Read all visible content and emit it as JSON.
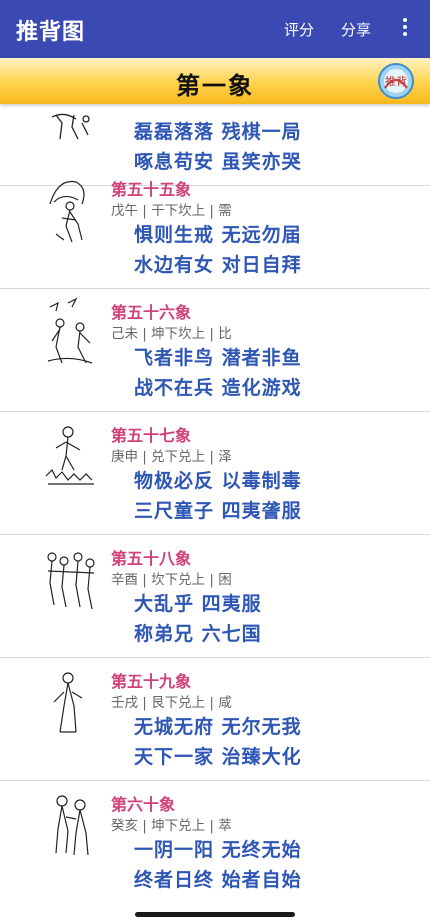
{
  "appbar": {
    "title": "推背图",
    "rate_label": "评分",
    "share_label": "分享",
    "more_icon": "more-vert-icon"
  },
  "banner": {
    "title": "第一象",
    "logo_text": "推背"
  },
  "items": [
    {
      "name": "",
      "gua": "",
      "line1": "磊磊落落  残棋一局",
      "line2": "啄息苟安  虽笑亦哭"
    },
    {
      "name": "第五十五象",
      "gua": "戊午 | 干下坎上 | 需",
      "line1": "惧则生戒  无远勿届",
      "line2": "水边有女  对日自拜"
    },
    {
      "name": "第五十六象",
      "gua": "己未 | 坤下坎上 | 比",
      "line1": "飞者非鸟  潜者非鱼",
      "line2": "战不在兵  造化游戏"
    },
    {
      "name": "第五十七象",
      "gua": "庚申 | 兑下兑上 | 泽",
      "line1": "物极必反  以毒制毒",
      "line2": "三尺童子  四夷詟服"
    },
    {
      "name": "第五十八象",
      "gua": "辛酉 | 坎下兑上 | 困",
      "line1": "大乱乎  四夷服",
      "line2": "称弟兄  六七国"
    },
    {
      "name": "第五十九象",
      "gua": "壬戌 | 艮下兑上 | 咸",
      "line1": "无城无府  无尔无我",
      "line2": "天下一家  治臻大化"
    },
    {
      "name": "第六十象",
      "gua": "癸亥 | 坤下兑上 | 萃",
      "line1": "一阴一阳  无终无始",
      "line2": "终者日终  始者自始"
    }
  ]
}
